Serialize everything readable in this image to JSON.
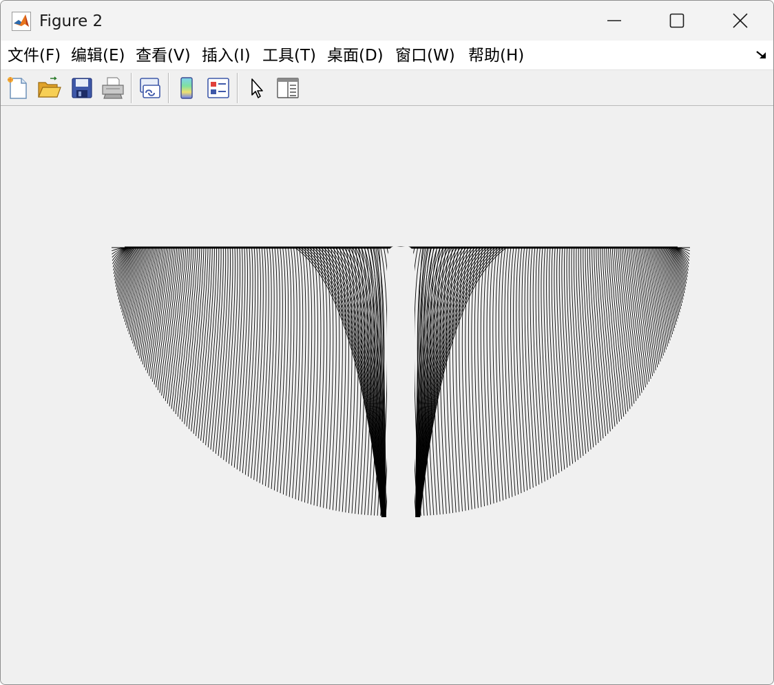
{
  "window": {
    "title": "Figure 2",
    "app_icon": "matlab-logo-icon",
    "controls": [
      "minimize-icon",
      "maximize-icon",
      "close-icon"
    ]
  },
  "menubar": {
    "items": [
      {
        "label": "文件(F)",
        "mnemonic": "F"
      },
      {
        "label": "编辑(E)",
        "mnemonic": "E"
      },
      {
        "label": "查看(V)",
        "mnemonic": "V"
      },
      {
        "label": "插入(I)",
        "mnemonic": "I"
      },
      {
        "label": "工具(T)",
        "mnemonic": "T"
      },
      {
        "label": "桌面(D)",
        "mnemonic": "D"
      },
      {
        "label": "窗口(W)",
        "mnemonic": "W"
      },
      {
        "label": "帮助(H)",
        "mnemonic": "H"
      }
    ],
    "dock_icon": "dock-arrow-icon"
  },
  "toolbar": {
    "buttons": [
      "new-figure-icon",
      "open-file-icon",
      "save-icon",
      "print-icon",
      "link-plot-icon",
      "insert-colorbar-icon",
      "insert-legend-icon",
      "edit-plot-pointer-icon",
      "property-inspector-icon"
    ]
  },
  "figure": {
    "description_color": "#000000",
    "background": "#f0f0f0",
    "line_color": "#000000"
  }
}
